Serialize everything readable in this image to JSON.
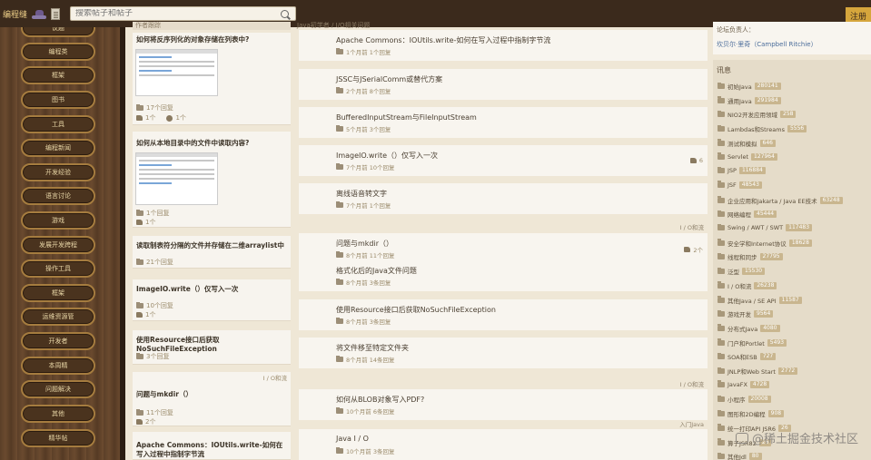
{
  "header": {
    "logo": "编程缝",
    "search_placeholder": "搜索帖子和帖子",
    "register": "注册"
  },
  "sidebar": {
    "items": [
      "议题",
      "编程类",
      "框架",
      "图书",
      "工具",
      "编程新闻",
      "开发经验",
      "语言讨论",
      "游戏",
      "发展开发跨程",
      "操作工具",
      "框架",
      "运维资源管",
      "开发者",
      "本周精",
      "问题解决",
      "其他",
      "精华帖"
    ]
  },
  "left_column": {
    "header": "作者跟踪",
    "cards": [
      {
        "title": "如何将反序列化的对象存储在列表中?",
        "meta1": "17个回复",
        "meta2a": "1个",
        "meta2b": "1个"
      },
      {
        "title": "如何从本地目录中的文件中读取内容?",
        "meta1": "1个回复",
        "meta2a": "1个"
      },
      {
        "title": "读取制表符分隔的文件并存储在二维arraylist中",
        "meta1": "21个回复"
      },
      {
        "title": "ImageIO.write（）仅写入一次",
        "meta1": "10个回复",
        "meta2a": "1个"
      },
      {
        "title": "使用Resource接口后获取NoSuchFileException",
        "meta1": "3个回复"
      },
      {
        "title": "问题与mkdir（）",
        "meta1": "11个回复",
        "meta2a": "2个",
        "tag": "I / O和流"
      },
      {
        "title": "Apache Commons：IOUtils.write-如何在写入过程中指制字节流"
      }
    ]
  },
  "middle_column": {
    "header": "Java初学者 / I/O相关问题",
    "rows": [
      {
        "title": "Apache Commons：IOUtils.write-如何在写入过程中指制字节流",
        "meta": "1个月前  1个回复"
      },
      {
        "title": "JSSC与JSerialComm或替代方案",
        "meta": "2个月前  8个回复"
      },
      {
        "title": "BufferedInputStream与FileInputStream",
        "meta": "5个月前  3个回复"
      },
      {
        "title": "ImageIO.write（）仅写入一次",
        "meta": "7个月前  10个回复",
        "right": "6"
      },
      {
        "title": "离线语音转文字",
        "meta": "7个月前  1个回复"
      },
      {
        "title": "问题与mkdir（）",
        "meta": "8个月前  11个回复",
        "right": "2个"
      },
      {
        "title": "格式化后的Java文件问题",
        "meta": "8个月前  3条回复"
      },
      {
        "title": "使用Resource接口后获取NoSuchFileException",
        "meta": "8个月前  3条回复"
      },
      {
        "title": "将文件移至特定文件夹",
        "meta": "8个月前  14条回复"
      },
      {
        "title": "如何从BLOB对象写入PDF?",
        "meta": "10个月前  6条回复"
      },
      {
        "title": "Java I / O",
        "meta": "10个月前  3条回复"
      }
    ],
    "dividers": [
      "I / O和流",
      "I / O和流",
      "I / O和流",
      "入门Java"
    ]
  },
  "right_column": {
    "moderator_label": "论坛负责人：",
    "moderator_name": "坎贝尔·里奇（Campbell Ritchie）",
    "forums_label": "讯息",
    "forums": [
      {
        "name": "初始Java",
        "count": "280141"
      },
      {
        "name": "通用Java",
        "count": "291984"
      },
      {
        "name": "NIO2开发应用领域",
        "count": "258"
      },
      {
        "name": "Lambdas和Streams",
        "count": "5556"
      },
      {
        "name": "测试和模拟",
        "count": "646"
      },
      {
        "name": "Servlet",
        "count": "127964"
      },
      {
        "name": "JSP",
        "count": "116884"
      },
      {
        "name": "JSF",
        "count": "48543"
      },
      {
        "name": "企业应用和Jakarta / Java EE技术",
        "count": "63248"
      },
      {
        "name": "网络编程",
        "count": "45444"
      },
      {
        "name": "Swing / AWT / SWT",
        "count": "117483"
      },
      {
        "name": "安全学和Internet协议",
        "count": "18628"
      },
      {
        "name": "线程和同步",
        "count": "27795"
      },
      {
        "name": "泛型",
        "count": "15530"
      },
      {
        "name": "I / O和流",
        "count": "26238"
      },
      {
        "name": "其他Java / SE API",
        "count": "11587"
      },
      {
        "name": "游戏开发",
        "count": "9564"
      },
      {
        "name": "分布式Java",
        "count": "4080"
      },
      {
        "name": "门户和Portlet",
        "count": "5493"
      },
      {
        "name": "SOA和ESB",
        "count": "727"
      },
      {
        "name": "JNLP和Web Start",
        "count": "2772"
      },
      {
        "name": "JavaFX",
        "count": "4728"
      },
      {
        "name": "小程序",
        "count": "20008"
      },
      {
        "name": "图形和2D编程",
        "count": "908"
      },
      {
        "name": "统一打印API JSR6",
        "count": "26"
      },
      {
        "name": "算子JSR82",
        "count": "26"
      },
      {
        "name": "其他Jdl",
        "count": "80"
      }
    ]
  },
  "watermark": "@稀土掘金技术社区"
}
